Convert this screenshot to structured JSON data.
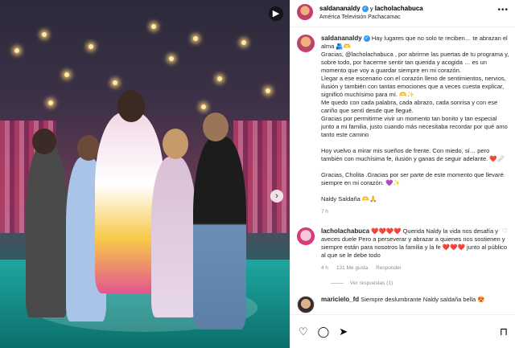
{
  "post": {
    "author": "saldananaldy",
    "connector": "y",
    "coauthor": "lacholachabuca",
    "location": "América Televisión Pachacamac"
  },
  "caption": {
    "author": "saldananaldy",
    "paragraphs": [
      "Hay lugares que no solo te reciben… te abrazan el alma 🫂🫶",
      "Gracias, @lacholachabuca , por abrirme las puertas de tu programa y, sobre todo, por hacerme sentir tan querida y acogida … es un momento que voy a guardar siempre en mi corazón.",
      "Llegar a ese escenario con el corazón lleno de sentimientos, nervios, ilusión y también con tantas emociones que a veces cuesta explicar, significó muchísimo para mí. 🫶✨",
      "Me quedo con cada palabra, cada abrazo, cada sonrisa y con ese cariño que sentí desde que llegué.",
      "Gracias por permitirme vivir un momento tan bonito y tan especial junto a mi familia, justo cuando más necesitaba recordar por qué amo tanto este camino",
      "Hoy vuelvo a mirar mis sueños de frente. Con miedo, sí… pero también con muchísima fe, ilusión y ganas de seguir adelante. ❤️🩹",
      "Gracias, Cholita .Gracias por ser parte de este momento que llevaré siempre en mi corazón. 💜✨",
      "Naldy Saldaña 🫶🙏"
    ],
    "time": "7 h"
  },
  "comment": {
    "author": "lacholachabuca",
    "hearts": "❤️❤️❤️❤️",
    "text": "Querida Naldy la vida nos desafía y aveces duele Pero a perseverar y abrazar a quienes nos sostienen y siempre están para nosotros la familia y la fe ❤️❤️❤️ junto al público al que se le debe todo",
    "time": "4 h",
    "likes": "131 Me gusta",
    "reply": "Responder",
    "view_replies": "Ver respuestas (1)"
  },
  "next_comment": {
    "author": "maricielo_fd",
    "text": "Siempre deslumbrante Naldy saldaña bella 😍"
  },
  "icons": {
    "more": "more-icon",
    "reels": "reels-icon",
    "like": "heart-icon",
    "comment": "comment-icon",
    "share": "share-icon",
    "save": "bookmark-icon"
  },
  "colors": {
    "verified": "#3897f0",
    "link": "#00376b",
    "meta": "#8e8e8e"
  }
}
